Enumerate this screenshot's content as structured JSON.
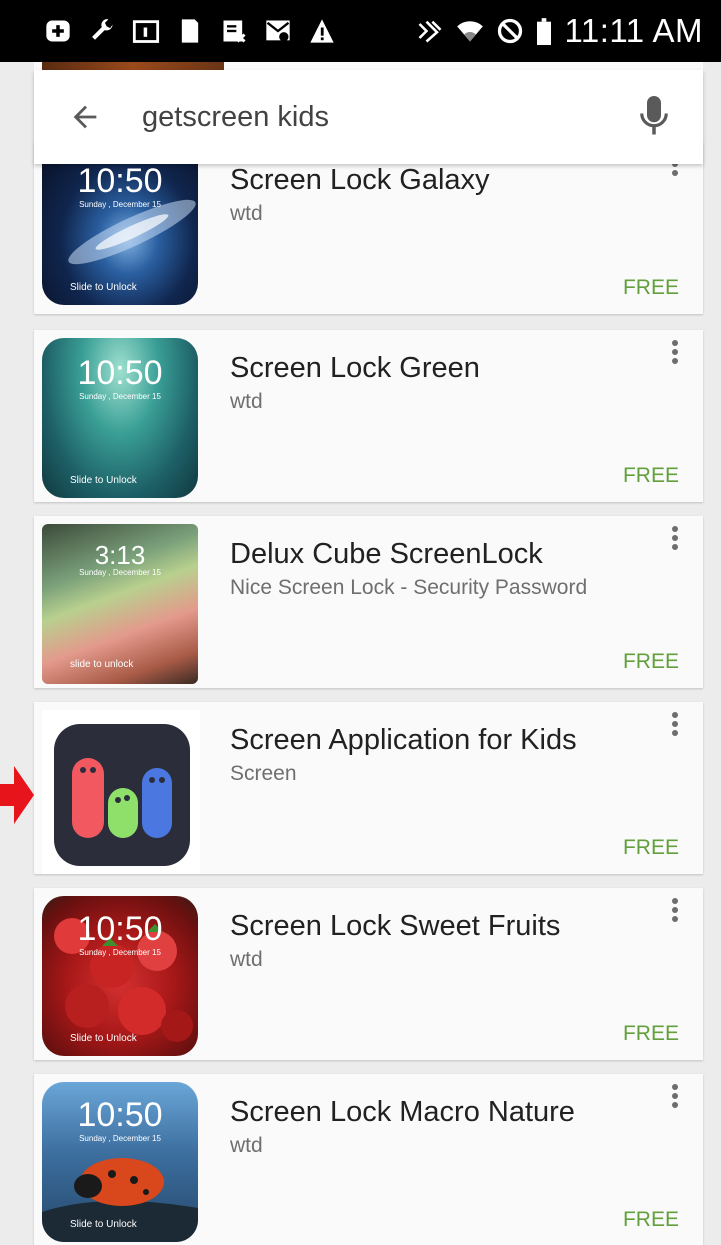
{
  "status_bar": {
    "time": "11:11 AM",
    "icons": [
      "add-box-icon",
      "wrench-icon",
      "tablet-icon",
      "phone-icon",
      "sim-icon",
      "email-icon",
      "warning-icon",
      "nfc-icon",
      "wifi-icon",
      "block-icon",
      "battery-icon"
    ]
  },
  "search": {
    "query": "getscreen kids",
    "back_icon": "arrow-left-icon",
    "mic_icon": "mic-icon"
  },
  "results": [
    {
      "title": "Screen Lock Galaxy",
      "developer": "wtd",
      "price": "FREE",
      "thumb_time": "10:50",
      "thumb_date": "Sunday , December 15",
      "thumb_slide": "Slide to Unlock"
    },
    {
      "title": "Screen Lock Green",
      "developer": "wtd",
      "price": "FREE",
      "thumb_time": "10:50",
      "thumb_date": "Sunday , December 15",
      "thumb_slide": "Slide to Unlock"
    },
    {
      "title": "Delux Cube ScreenLock",
      "developer": "Nice Screen Lock - Security Password",
      "price": "FREE",
      "thumb_time": "3:13",
      "thumb_date": "Sunday , December 15",
      "thumb_slide": "slide to unlock"
    },
    {
      "title": "Screen Application for Kids",
      "developer": "Screen",
      "price": "FREE"
    },
    {
      "title": "Screen Lock Sweet Fruits",
      "developer": "wtd",
      "price": "FREE",
      "thumb_time": "10:50",
      "thumb_date": "Sunday , December 15",
      "thumb_slide": "Slide to Unlock"
    },
    {
      "title": "Screen Lock Macro Nature",
      "developer": "wtd",
      "price": "FREE",
      "thumb_time": "10:50",
      "thumb_date": "Sunday , December 15",
      "thumb_slide": "Slide to Unlock"
    }
  ],
  "colors": {
    "price": "#62a03b",
    "annotation_arrow": "#e8141c",
    "kids_icon_bg": "#2b2d3a",
    "kids_pink": "#f2585f",
    "kids_green": "#8fe06b",
    "kids_blue": "#4a78e0"
  }
}
